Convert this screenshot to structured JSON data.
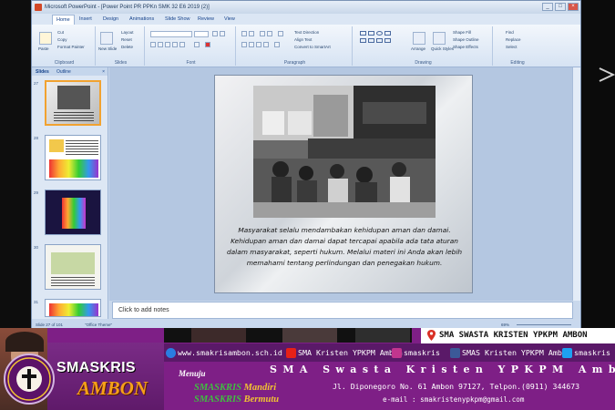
{
  "window": {
    "title": "Microsoft PowerPoint - [Power Point PR PPKn SMK 32 E6 2019 (2)]",
    "controls": [
      "_",
      "□",
      "×"
    ]
  },
  "ribbon": {
    "tabs": [
      "Home",
      "Insert",
      "Design",
      "Animations",
      "Slide Show",
      "Review",
      "View"
    ],
    "active_tab": "Home",
    "groups": {
      "clipboard": {
        "label": "Clipboard",
        "paste": "Paste",
        "cut": "Cut",
        "copy": "Copy",
        "format_painter": "Format Painter"
      },
      "slides": {
        "label": "Slides",
        "new_slide": "New Slide",
        "layout": "Layout",
        "reset": "Reset",
        "delete": "Delete"
      },
      "font": {
        "label": "Font"
      },
      "paragraph": {
        "label": "Paragraph",
        "text_direction": "Text Direction",
        "align_text": "Align Text",
        "smartart": "Convert to SmartArt"
      },
      "drawing": {
        "label": "Drawing",
        "arrange": "Arrange",
        "quick_styles": "Quick Styles",
        "shape_fill": "Shape Fill",
        "shape_outline": "Shape Outline",
        "shape_effects": "Shape Effects"
      },
      "editing": {
        "label": "Editing",
        "find": "Find",
        "replace": "Replace",
        "select": "Select"
      }
    }
  },
  "panel": {
    "tabs": [
      "Slides",
      "Outline"
    ],
    "close": "×",
    "slide_numbers": [
      "27",
      "28",
      "29",
      "30",
      "31"
    ],
    "active_slide": "27"
  },
  "slide": {
    "caption": "Masyarakat selalu mendambakan kehidupan aman dan damai. Kehidupan aman dan damai dapat tercapai apabila ada tata aturan dalam masyarakat, seperti hukum. Melalui materi ini Anda akan lebih memahami tentang perlindungan dan penegakan hukum."
  },
  "notes": {
    "placeholder": "Click to add notes"
  },
  "statusbar": {
    "slide_info": "Slide 27 of 101",
    "theme": "\"Office Theme\"",
    "zoom": "69%"
  },
  "banner": {
    "brand_line1": "SMASKRIS",
    "brand_line2": "AMBON",
    "top_title": "SMA SWASTA KRISTEN YPKPM AMBON",
    "links": {
      "website": "www.smakrisambon.sch.id",
      "youtube": "SMA Kristen YPKPM Ambon",
      "instagram": "smaskris",
      "facebook": "SMAS Kristen YPKPM Ambon",
      "twitter": "smaskris"
    },
    "school_name": "SMA Swasta Kristen YPKPM Ambon",
    "menuju": "Menuju",
    "motto1_white": "SMASKRIS",
    "motto1_yellow": "Mandiri",
    "motto2_white": "SMASKRIS",
    "motto2_yellow": "Bermutu",
    "address": "Jl. Diponegoro  No. 61 Ambon 97127, Telpon.(0911) 344673",
    "email": "e-mail : smakristenypkpm@gmail.com"
  },
  "colors": {
    "banner_purple": "#7e1f86",
    "accent_orange": "#f6a019",
    "ribbon_blue": "#dbe6f4",
    "active_thumb": "#f1a230"
  }
}
